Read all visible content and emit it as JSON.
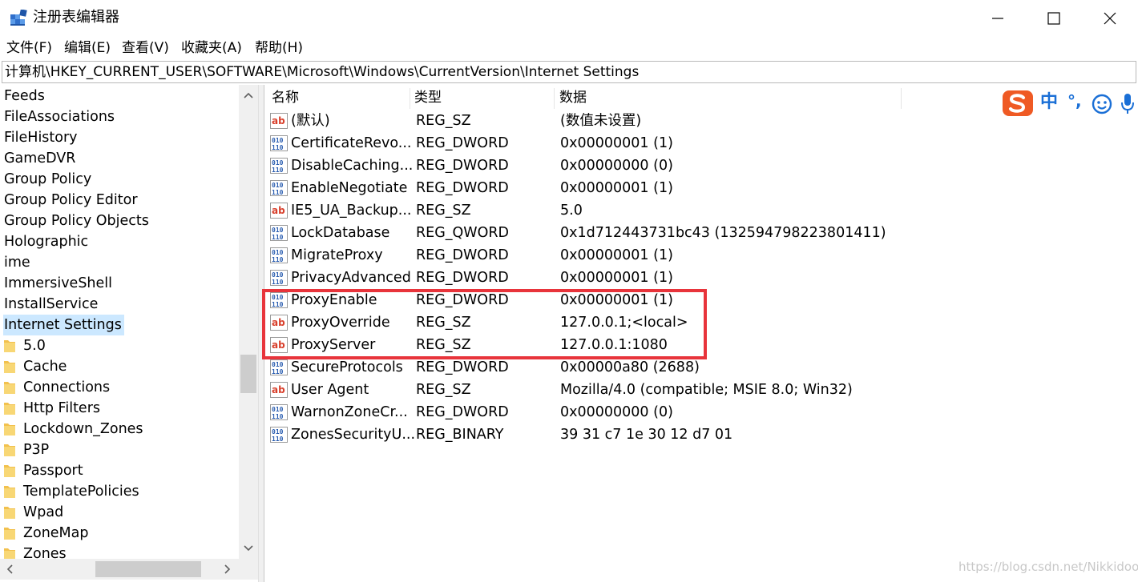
{
  "window": {
    "title": "注册表编辑器",
    "icons": {
      "app": "registry-editor-icon",
      "minimize": "minimize-icon",
      "maximize": "maximize-icon",
      "close": "close-icon"
    }
  },
  "menu": [
    "文件(F)",
    "编辑(E)",
    "查看(V)",
    "收藏夹(A)",
    "帮助(H)"
  ],
  "address": {
    "path": "计算机\\HKEY_CURRENT_USER\\SOFTWARE\\Microsoft\\Windows\\CurrentVersion\\Internet Settings"
  },
  "tree": {
    "items": [
      {
        "label": "Feeds",
        "child": false
      },
      {
        "label": "FileAssociations",
        "child": false
      },
      {
        "label": "FileHistory",
        "child": false
      },
      {
        "label": "GameDVR",
        "child": false
      },
      {
        "label": "Group Policy",
        "child": false
      },
      {
        "label": "Group Policy Editor",
        "child": false
      },
      {
        "label": "Group Policy Objects",
        "child": false
      },
      {
        "label": "Holographic",
        "child": false
      },
      {
        "label": "ime",
        "child": false
      },
      {
        "label": "ImmersiveShell",
        "child": false
      },
      {
        "label": "InstallService",
        "child": false
      },
      {
        "label": "Internet Settings",
        "child": false,
        "selected": true
      },
      {
        "label": "5.0",
        "child": true
      },
      {
        "label": "Cache",
        "child": true
      },
      {
        "label": "Connections",
        "child": true
      },
      {
        "label": "Http Filters",
        "child": true
      },
      {
        "label": "Lockdown_Zones",
        "child": true
      },
      {
        "label": "P3P",
        "child": true
      },
      {
        "label": "Passport",
        "child": true
      },
      {
        "label": "TemplatePolicies",
        "child": true
      },
      {
        "label": "Wpad",
        "child": true
      },
      {
        "label": "ZoneMap",
        "child": true
      },
      {
        "label": "Zones",
        "child": true
      }
    ]
  },
  "columns": {
    "name": "名称",
    "type": "类型",
    "data": "数据"
  },
  "values": [
    {
      "name": "(默认)",
      "type": "REG_SZ",
      "data": "(数值未设置)",
      "icon": "string-value-icon"
    },
    {
      "name": "CertificateRevo...",
      "type": "REG_DWORD",
      "data": "0x00000001 (1)",
      "icon": "binary-value-icon"
    },
    {
      "name": "DisableCaching...",
      "type": "REG_DWORD",
      "data": "0x00000000 (0)",
      "icon": "binary-value-icon"
    },
    {
      "name": "EnableNegotiate",
      "type": "REG_DWORD",
      "data": "0x00000001 (1)",
      "icon": "binary-value-icon"
    },
    {
      "name": "IE5_UA_Backup...",
      "type": "REG_SZ",
      "data": "5.0",
      "icon": "string-value-icon"
    },
    {
      "name": "LockDatabase",
      "type": "REG_QWORD",
      "data": "0x1d712443731bc43 (132594798223801411)",
      "icon": "binary-value-icon"
    },
    {
      "name": "MigrateProxy",
      "type": "REG_DWORD",
      "data": "0x00000001 (1)",
      "icon": "binary-value-icon"
    },
    {
      "name": "PrivacyAdvanced",
      "type": "REG_DWORD",
      "data": "0x00000001 (1)",
      "icon": "binary-value-icon"
    },
    {
      "name": "ProxyEnable",
      "type": "REG_DWORD",
      "data": "0x00000001 (1)",
      "icon": "binary-value-icon"
    },
    {
      "name": "ProxyOverride",
      "type": "REG_SZ",
      "data": "127.0.0.1;<local>",
      "icon": "string-value-icon"
    },
    {
      "name": "ProxyServer",
      "type": "REG_SZ",
      "data": "127.0.0.1:1080",
      "icon": "string-value-icon"
    },
    {
      "name": "SecureProtocols",
      "type": "REG_DWORD",
      "data": "0x00000a80 (2688)",
      "icon": "binary-value-icon"
    },
    {
      "name": "User Agent",
      "type": "REG_SZ",
      "data": "Mozilla/4.0 (compatible; MSIE 8.0; Win32)",
      "icon": "string-value-icon"
    },
    {
      "name": "WarnonZoneCr...",
      "type": "REG_DWORD",
      "data": "0x00000000 (0)",
      "icon": "binary-value-icon"
    },
    {
      "name": "ZonesSecurityU...",
      "type": "REG_BINARY",
      "data": "39 31 c7 1e 30 12 d7 01",
      "icon": "binary-value-icon"
    }
  ],
  "ime": {
    "mode": "中",
    "punct": "°,",
    "icons": [
      "sogou-logo-icon",
      "emoji-icon",
      "microphone-icon"
    ]
  },
  "watermark": "https://blog.csdn.net/Nikkidoog",
  "colors": {
    "selection": "#cce8ff",
    "highlight_border": "#e8343b",
    "ime_brand": "#ef5a24",
    "ime_blue": "#1a6fd6"
  }
}
